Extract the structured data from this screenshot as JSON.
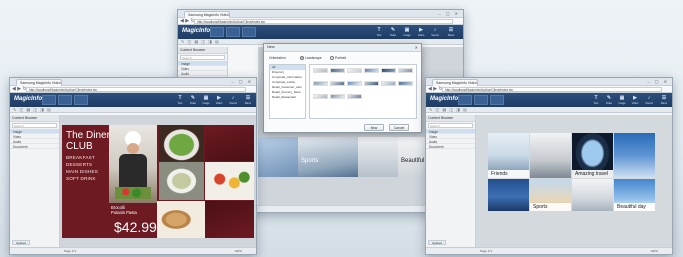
{
  "browser": {
    "tab_title": "Samsung MagicInfo VideoWall Author",
    "url": "http://localhost/MagicInfo/Author/Client/index.jsp",
    "nav": "◀ ▶ ↻",
    "window_buttons": "– ▢ ✕"
  },
  "app": {
    "logo": "MagicInfo",
    "toolbar_icons": "✎ ◰ ▦ ◫ ◨ ▤",
    "header_icons": [
      {
        "glyph": "T",
        "label": "Text"
      },
      {
        "glyph": "✎",
        "label": "Draw"
      },
      {
        "glyph": "▣",
        "label": "Image"
      },
      {
        "glyph": "▶",
        "label": "Video"
      },
      {
        "glyph": "♪",
        "label": "Sound"
      },
      {
        "glyph": "☰",
        "label": "Menu"
      }
    ]
  },
  "sidebar": {
    "title": "Content Browser",
    "search_placeholder": "Search",
    "items": [
      "Image",
      "Video",
      "Audio",
      "Document"
    ],
    "footer_button": "Upload"
  },
  "status": {
    "page_label": "Page 1/1",
    "zoom": "100%"
  },
  "dialog": {
    "title": "New",
    "field_label": "Orientation",
    "radio_landscape": "Landscape",
    "radio_portrait": "Portrait",
    "folders": [
      "All",
      "Directory",
      "Corporate_Information",
      "Corporate_Lobby",
      "Retail_Customer_care",
      "Retail_Grocery_Store",
      "Retail_Restaurant"
    ],
    "ok_label": "New",
    "cancel_label": "Cancel"
  },
  "diners": {
    "title_line1": "The Diners",
    "title_line2": "CLUB",
    "menu_items": [
      "BREAKFAST",
      "DESSERTS",
      "MAIN DISHES",
      "SOFT DRINK"
    ],
    "dish_line1": "Brocolli",
    "dish_line2": "Putanis Pasta",
    "price": "$42.99"
  },
  "center_captions": {
    "sports": "Sports",
    "beautiful": "Beautiful day"
  },
  "right_captions": {
    "friends": "Friends",
    "amazing": "Amazing travel",
    "sports": "Sports",
    "beautiful": "Beautiful day"
  },
  "colors": {
    "accent": "#1f3c63",
    "diners_bg": "#6d1a22"
  }
}
